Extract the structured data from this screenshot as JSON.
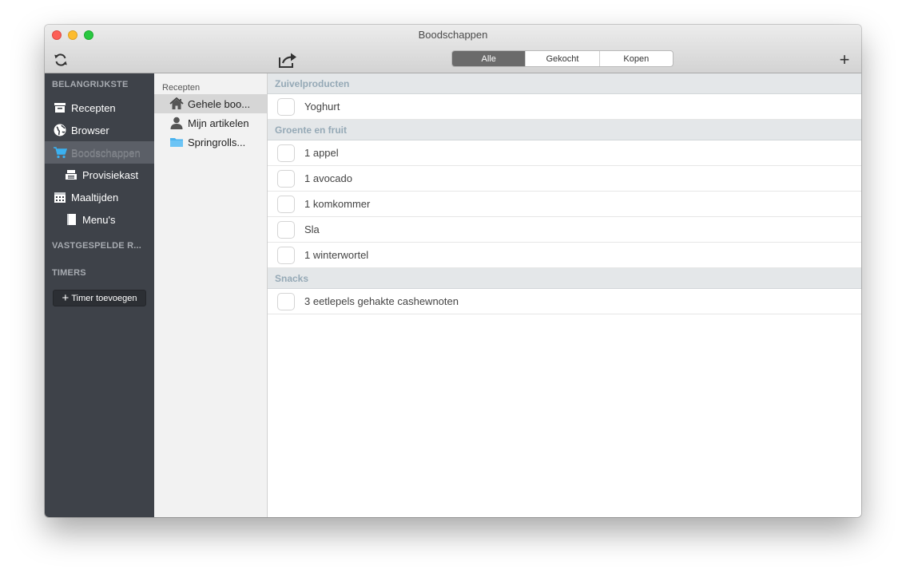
{
  "window": {
    "title": "Boodschappen"
  },
  "toolbar": {
    "refresh_icon": "refresh-icon",
    "share_icon": "share-icon",
    "add_icon": "plus-icon",
    "add_label": "+",
    "segments": [
      {
        "label": "Alle",
        "active": true
      },
      {
        "label": "Gekocht",
        "active": false
      },
      {
        "label": "Kopen",
        "active": false
      }
    ]
  },
  "sidebar": {
    "section_main": "BELANGRIJKSTE",
    "items": [
      {
        "label": "Recepten",
        "icon": "recipe-box-icon"
      },
      {
        "label": "Browser",
        "icon": "globe-icon"
      },
      {
        "label": "Boodschappen",
        "icon": "shopping-cart-icon",
        "selected": true
      },
      {
        "label": "Provisiekast",
        "icon": "pantry-icon"
      },
      {
        "label": "Maaltijden",
        "icon": "calendar-icon"
      },
      {
        "label": "Menu's",
        "icon": "menu-book-icon"
      }
    ],
    "section_pinned": "VASTGESPELDE R...",
    "section_timers": "TIMERS",
    "timer_button": "Timer toevoegen",
    "timer_plus": "+"
  },
  "lists": {
    "header": "Recepten",
    "items": [
      {
        "label": "Gehele boo...",
        "icon": "home-icon",
        "selected": true
      },
      {
        "label": "Mijn artikelen",
        "icon": "person-icon"
      },
      {
        "label": "Springrolls...",
        "icon": "folder-icon"
      }
    ]
  },
  "groceries": {
    "groups": [
      {
        "name": "Zuivelproducten",
        "items": [
          "Yoghurt"
        ]
      },
      {
        "name": "Groente en fruit",
        "items": [
          "1 appel",
          "1 avocado",
          "1 komkommer",
          "Sla",
          "1 winterwortel"
        ]
      },
      {
        "name": "Snacks",
        "items": [
          "3 eetlepels gehakte cashewnoten"
        ]
      }
    ]
  },
  "colors": {
    "sidebar_bg": "#3e4249",
    "group_header_text": "#95a9b6",
    "segment_active": "#6b6b6b",
    "close": "#fc5f57",
    "minimize": "#fdbc2e",
    "maximize": "#28c840"
  }
}
